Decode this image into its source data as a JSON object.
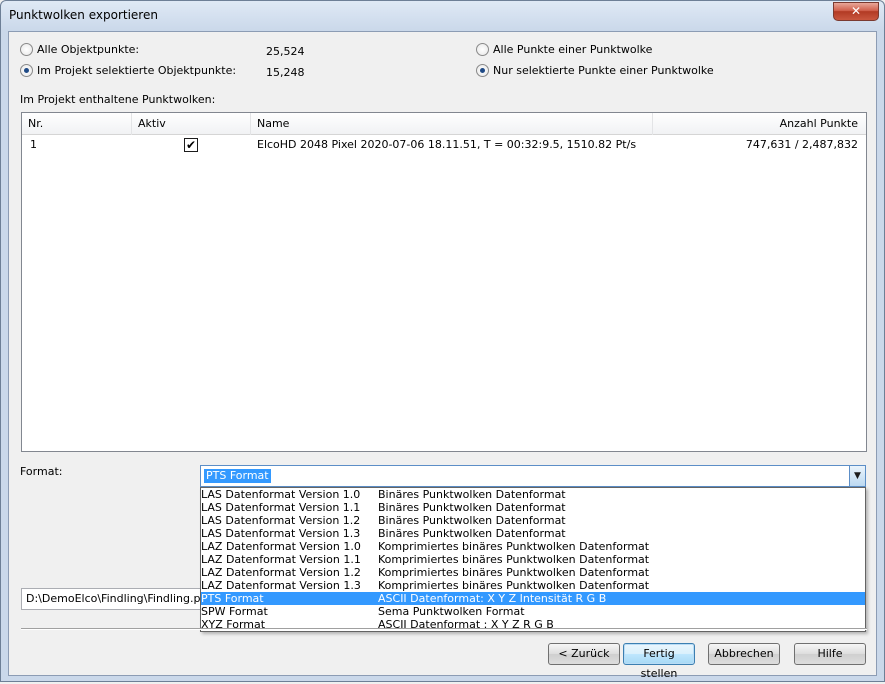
{
  "window": {
    "title": "Punktwolken exportieren",
    "close_label": "✕"
  },
  "options": {
    "all_objects_label": "Alle Objektpunkte:",
    "all_objects_value": "25,524",
    "selected_objects_label": "Im Projekt selektierte Objektpunkte:",
    "selected_objects_value": "15,248",
    "all_points_label": "Alle Punkte einer Punktwolke",
    "selected_points_label": "Nur selektierte Punkte einer Punktwolke"
  },
  "list": {
    "caption": "Im Projekt enthaltene Punktwolken:",
    "columns": [
      "Nr.",
      "Aktiv",
      "Name",
      "Anzahl Punkte"
    ],
    "rows": [
      {
        "nr": "1",
        "aktiv": "✔",
        "name": "ElcoHD 2048 Pixel 2020-07-06  18.11.51,   T = 00:32:9.5,     1510.82 Pt/s",
        "count": "747,631 / 2,487,832"
      }
    ]
  },
  "format": {
    "label": "Format:",
    "selected": "PTS Format",
    "options": [
      {
        "name": "LAS Datenformat Version  1.0",
        "desc": "Binäres Punktwolken Datenformat"
      },
      {
        "name": "LAS Datenformat Version  1.1",
        "desc": "Binäres Punktwolken Datenformat"
      },
      {
        "name": "LAS Datenformat Version  1.2",
        "desc": "Binäres Punktwolken Datenformat"
      },
      {
        "name": "LAS Datenformat Version  1.3",
        "desc": "Binäres Punktwolken Datenformat"
      },
      {
        "name": "LAZ Datenformat Version 1.0",
        "desc": "Komprimiertes binäres Punktwolken Datenformat"
      },
      {
        "name": "LAZ Datenformat Version 1.1",
        "desc": "Komprimiertes binäres Punktwolken Datenformat"
      },
      {
        "name": "LAZ Datenformat Version 1.2",
        "desc": "Komprimiertes binäres Punktwolken Datenformat"
      },
      {
        "name": "LAZ Datenformat Version 1.3",
        "desc": "Komprimiertes binäres Punktwolken Datenformat"
      },
      {
        "name": "PTS Format",
        "desc": "ASCII Datenformat: X Y Z Intensität R G B"
      },
      {
        "name": "SPW Format",
        "desc": "Sema Punktwolken Format"
      },
      {
        "name": "XYZ Format",
        "desc": "ASCII Datenformat : X Y Z R G B"
      }
    ]
  },
  "path": {
    "value": "D:\\DemoElco\\Findling\\Findling.pts"
  },
  "buttons": {
    "back": "< Zurück",
    "finish": "Fertig stellen",
    "cancel": "Abbrechen",
    "help": "Hilfe"
  }
}
